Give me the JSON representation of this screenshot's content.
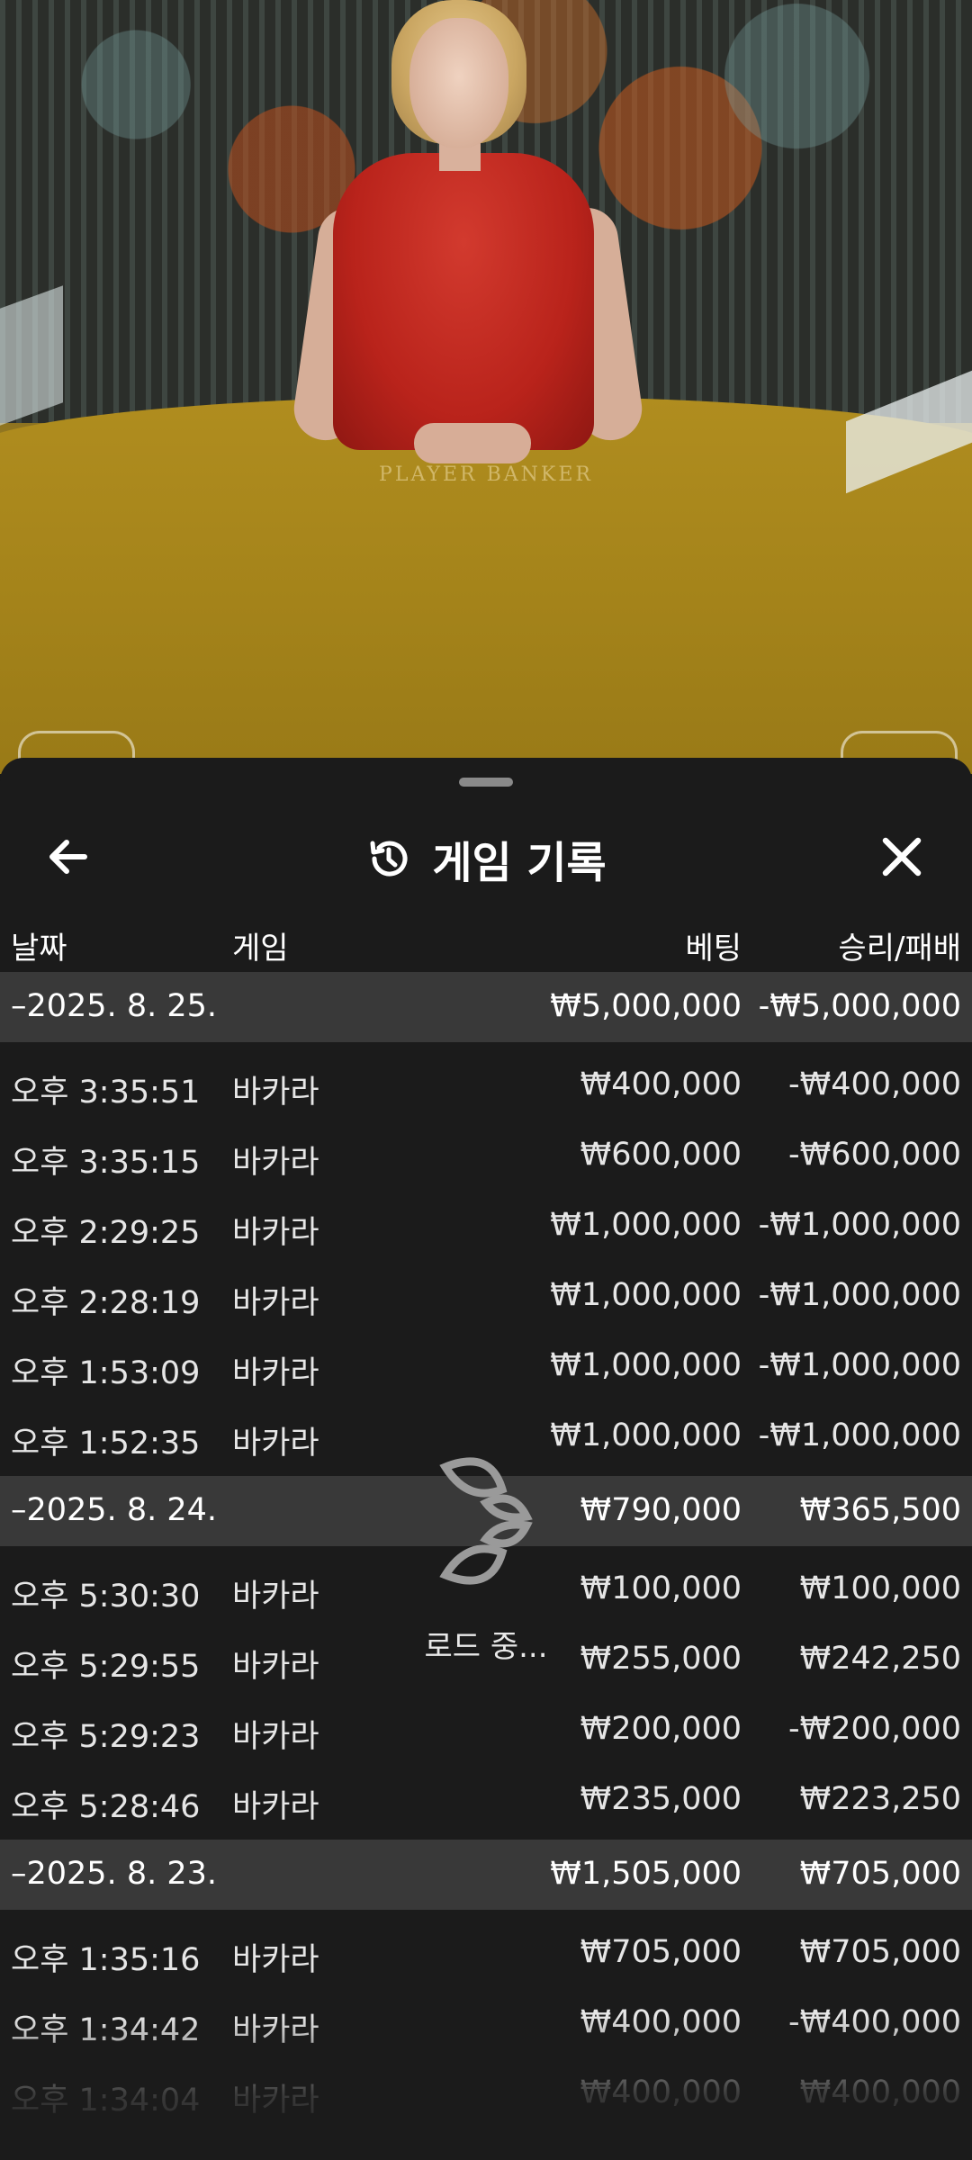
{
  "table_label": "PLAYER    BANKER",
  "sheet": {
    "title": "게임 기록",
    "icons": {
      "back": "arrow-left-icon",
      "history": "history-clock-icon",
      "close": "close-icon"
    }
  },
  "columns": {
    "date": "날짜",
    "game": "게임",
    "bet": "베팅",
    "result": "승리/패배"
  },
  "groups": [
    {
      "date": "–2025. 8. 25.",
      "bet": "₩5,000,000",
      "result": "-₩5,000,000",
      "rows": [
        {
          "time": "오후 3:35:51",
          "game": "바카라",
          "bet": "₩400,000",
          "result": "-₩400,000"
        },
        {
          "time": "오후 3:35:15",
          "game": "바카라",
          "bet": "₩600,000",
          "result": "-₩600,000"
        },
        {
          "time": "오후 2:29:25",
          "game": "바카라",
          "bet": "₩1,000,000",
          "result": "-₩1,000,000"
        },
        {
          "time": "오후 2:28:19",
          "game": "바카라",
          "bet": "₩1,000,000",
          "result": "-₩1,000,000"
        },
        {
          "time": "오후 1:53:09",
          "game": "바카라",
          "bet": "₩1,000,000",
          "result": "-₩1,000,000"
        },
        {
          "time": "오후 1:52:35",
          "game": "바카라",
          "bet": "₩1,000,000",
          "result": "-₩1,000,000"
        }
      ]
    },
    {
      "date": "–2025. 8. 24.",
      "bet": "₩790,000",
      "result": "₩365,500",
      "rows": [
        {
          "time": "오후 5:30:30",
          "game": "바카라",
          "bet": "₩100,000",
          "result": "₩100,000"
        },
        {
          "time": "오후 5:29:55",
          "game": "바카라",
          "bet": "₩255,000",
          "result": "₩242,250"
        },
        {
          "time": "오후 5:29:23",
          "game": "바카라",
          "bet": "₩200,000",
          "result": "-₩200,000"
        },
        {
          "time": "오후 5:28:46",
          "game": "바카라",
          "bet": "₩235,000",
          "result": "₩223,250"
        }
      ]
    },
    {
      "date": "–2025. 8. 23.",
      "bet": "₩1,505,000",
      "result": "₩705,000",
      "rows": [
        {
          "time": "오후 1:35:16",
          "game": "바카라",
          "bet": "₩705,000",
          "result": "₩705,000"
        },
        {
          "time": "오후 1:34:42",
          "game": "바카라",
          "bet": "₩400,000",
          "result": "-₩400,000"
        },
        {
          "time": "오후 1:34:04",
          "game": "바카라",
          "bet": "₩400,000",
          "result": "₩400,000"
        }
      ]
    }
  ],
  "loading": {
    "text": "로드 중...",
    "icon": "spinner-leaf-icon"
  }
}
